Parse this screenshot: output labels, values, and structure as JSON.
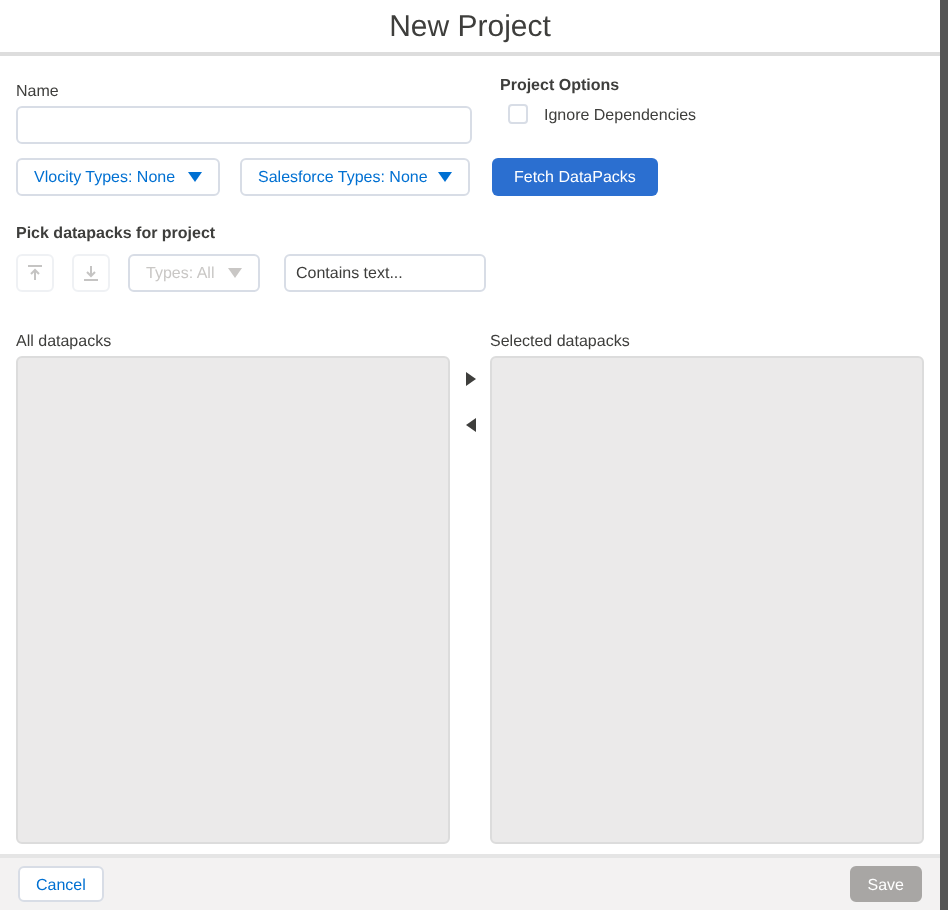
{
  "window": {
    "title": "New Project"
  },
  "name_field": {
    "label": "Name"
  },
  "project_options": {
    "title": "Project Options",
    "options": [
      {
        "label": "Ignore Dependencies",
        "checked": false
      }
    ]
  },
  "type_dropdowns": [
    {
      "label": "Vlocity Types: None"
    },
    {
      "label": "Salesforce Types: None"
    }
  ],
  "fetch_button": {
    "label": "Fetch DataPacks"
  },
  "picker": {
    "title": "Pick datapacks for project",
    "tools": [
      {
        "kind": "expand",
        "disabled": true
      },
      {
        "kind": "collapse",
        "disabled": true
      }
    ],
    "types_filter": {
      "label": "Types: All",
      "disabled": true
    },
    "search": {
      "placeholder": "Contains text..."
    }
  },
  "lists": [
    {
      "label": "All datapacks"
    },
    {
      "label": "Selected datapacks"
    }
  ],
  "footer": {
    "cancel": {
      "label": "Cancel",
      "disabled": false
    },
    "save": {
      "label": "Save",
      "disabled": true
    }
  }
}
